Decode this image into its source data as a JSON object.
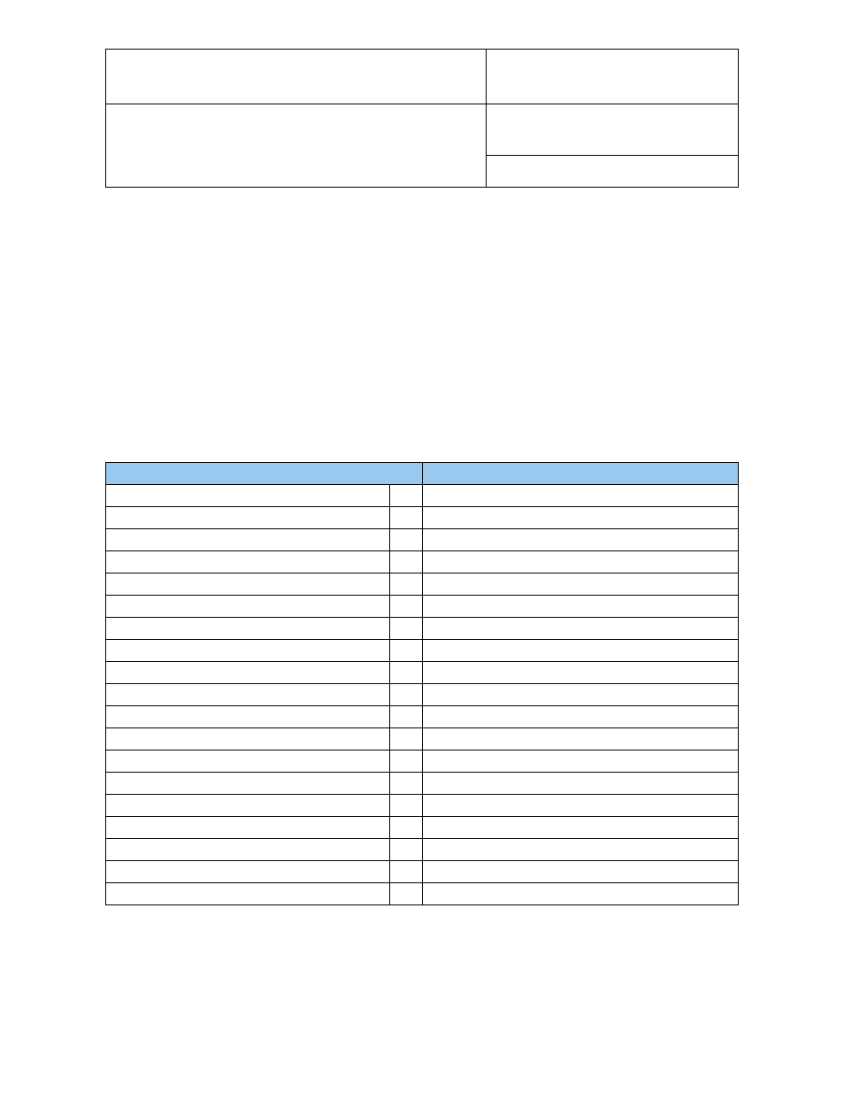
{
  "top_table": {
    "row1_cell1": "",
    "row1_cell2": "",
    "row2_cell1": "",
    "row2_cell2a": "",
    "row3_cell2": ""
  },
  "bottom_table": {
    "header_cell1": "",
    "header_cell2": "",
    "row_count": 19,
    "rows": [
      {
        "col1": "",
        "col2": "",
        "col3": ""
      },
      {
        "col1": "",
        "col2": "",
        "col3": ""
      },
      {
        "col1": "",
        "col2": "",
        "col3": ""
      },
      {
        "col1": "",
        "col2": "",
        "col3": ""
      },
      {
        "col1": "",
        "col2": "",
        "col3": ""
      },
      {
        "col1": "",
        "col2": "",
        "col3": ""
      },
      {
        "col1": "",
        "col2": "",
        "col3": ""
      },
      {
        "col1": "",
        "col2": "",
        "col3": ""
      },
      {
        "col1": "",
        "col2": "",
        "col3": ""
      },
      {
        "col1": "",
        "col2": "",
        "col3": ""
      },
      {
        "col1": "",
        "col2": "",
        "col3": ""
      },
      {
        "col1": "",
        "col2": "",
        "col3": ""
      },
      {
        "col1": "",
        "col2": "",
        "col3": ""
      },
      {
        "col1": "",
        "col2": "",
        "col3": ""
      },
      {
        "col1": "",
        "col2": "",
        "col3": ""
      },
      {
        "col1": "",
        "col2": "",
        "col3": ""
      },
      {
        "col1": "",
        "col2": "",
        "col3": ""
      },
      {
        "col1": "",
        "col2": "",
        "col3": ""
      },
      {
        "col1": "",
        "col2": "",
        "col3": ""
      }
    ]
  },
  "colors": {
    "header_bg": "#99c9ee",
    "border": "#000000"
  }
}
